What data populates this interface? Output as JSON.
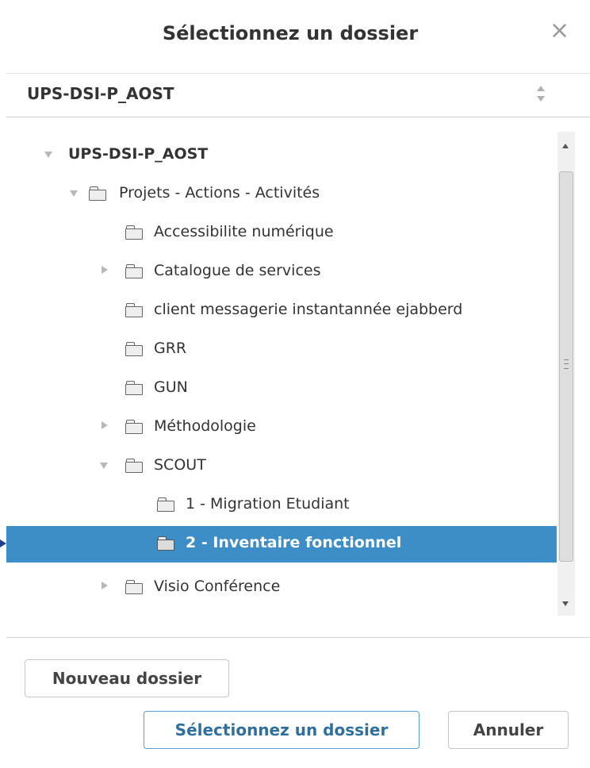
{
  "dialog": {
    "title": "Sélectionnez un dossier",
    "close_icon": "×"
  },
  "select": {
    "value": "UPS-DSI-P_AOST"
  },
  "tree": {
    "items": [
      {
        "label": "UPS-DSI-P_AOST",
        "toggle": "open",
        "folder": false,
        "bold": true,
        "level": 0
      },
      {
        "label": "Projets - Actions - Activités",
        "toggle": "open",
        "folder": true,
        "level": 1
      },
      {
        "label": "Accessibilite numérique",
        "toggle": "none",
        "folder": true,
        "level": 2
      },
      {
        "label": "Catalogue de services",
        "toggle": "closed",
        "folder": true,
        "level": 2
      },
      {
        "label": "client messagerie instantannée ejabberd",
        "toggle": "none",
        "folder": true,
        "level": 2
      },
      {
        "label": "GRR",
        "toggle": "none",
        "folder": true,
        "level": 2
      },
      {
        "label": "GUN",
        "toggle": "none",
        "folder": true,
        "level": 2
      },
      {
        "label": "Méthodologie",
        "toggle": "closed",
        "folder": true,
        "level": 2
      },
      {
        "label": "SCOUT",
        "toggle": "open",
        "folder": true,
        "level": 2
      },
      {
        "label": "1 - Migration Etudiant",
        "toggle": "none",
        "folder": true,
        "level": 3
      },
      {
        "label": "2 - Inventaire fonctionnel",
        "toggle": "none",
        "folder": true,
        "level": 3,
        "selected": true
      },
      {
        "label": "Visio Conférence",
        "toggle": "closed",
        "folder": true,
        "level": 2
      }
    ]
  },
  "footer": {
    "new_folder_label": "Nouveau dossier",
    "select_label": "Sélectionnez un dossier",
    "cancel_label": "Annuler"
  },
  "colors": {
    "selected_row": "#3d8ec7",
    "primary_border": "#5aa0cf"
  },
  "icons": [
    "close-icon",
    "spinner-icon",
    "expand-icon",
    "collapse-icon",
    "folder-icon",
    "scroll-up-icon",
    "scroll-down-icon"
  ]
}
